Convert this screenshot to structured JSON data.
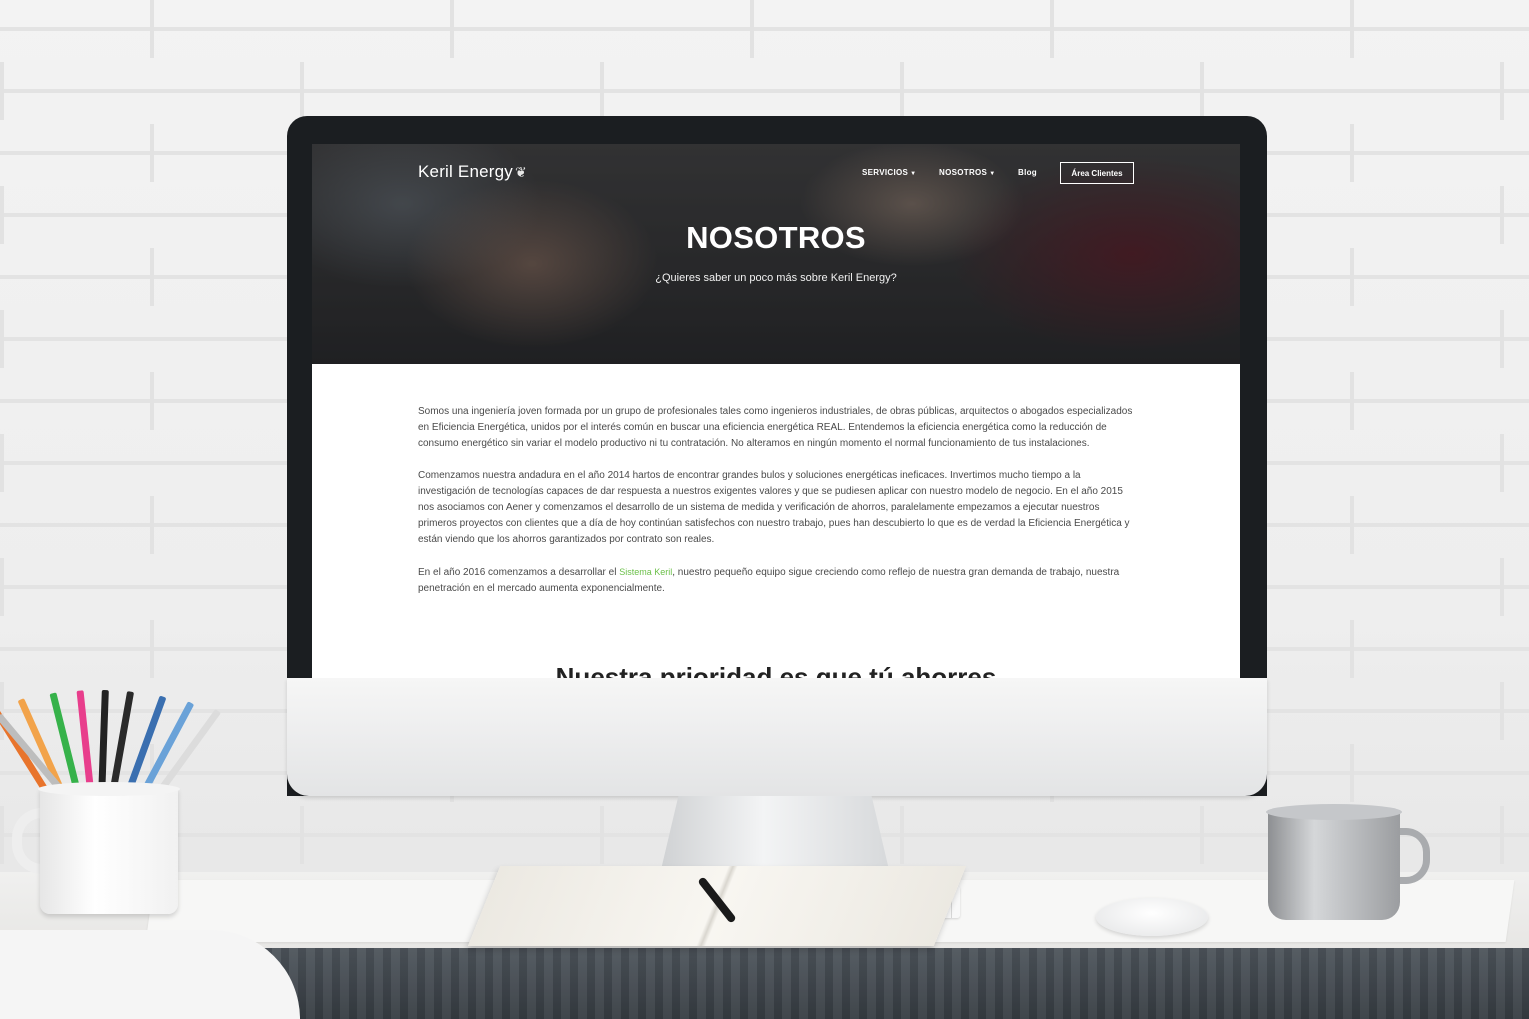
{
  "site": {
    "logo_text": "Keril Energy",
    "nav": {
      "servicios": "SERVICIOS",
      "nosotros": "NOSOTROS",
      "blog": "Blog",
      "area_clientes": "Área Clientes"
    },
    "hero": {
      "title": "NOSOTROS",
      "subtitle": "¿Quieres saber un poco más sobre Keril Energy?"
    },
    "content": {
      "p1": "Somos una ingeniería joven formada por un grupo de profesionales tales como ingenieros industriales, de obras públicas, arquitectos o abogados especializados en Eficiencia Energética, unidos por el interés común en buscar una eficiencia energética REAL. Entendemos la eficiencia energética como la reducción de consumo energético sin variar el modelo productivo ni tu contratación. No alteramos en ningún momento el normal funcionamiento de tus instalaciones.",
      "p2": "Comenzamos nuestra andadura en el año 2014 hartos de encontrar grandes bulos y soluciones energéticas ineficaces. Invertimos mucho tiempo a la investigación de tecnologías capaces de dar respuesta a nuestros exigentes valores y que se pudiesen aplicar con nuestro modelo de negocio. En el año 2015 nos asociamos con Aener y comenzamos el desarrollo de un sistema de medida y verificación de ahorros, paralelamente empezamos a ejecutar nuestros primeros proyectos con clientes que a día de hoy continúan satisfechos con nuestro trabajo, pues han descubierto lo que es de verdad la Eficiencia Energética y están viendo que los ahorros garantizados por contrato son reales.",
      "p3_before": "En el año 2016 comenzamos a desarrollar el ",
      "p3_link": "Sistema Keril",
      "p3_after": ", nuestro pequeño equipo sigue creciendo como reflejo de nuestra gran demanda de trabajo, nuestra penetración en el mercado aumenta exponencialmente.",
      "next_heading": "Nuestra prioridad es que tú ahorres"
    }
  },
  "colors": {
    "link": "#6cc04a",
    "text": "#4a4a4a",
    "bezel": "#1b1e21"
  },
  "icons": {
    "logo_leaf": "leaf-icon",
    "dropdown": "caret-down-icon"
  }
}
